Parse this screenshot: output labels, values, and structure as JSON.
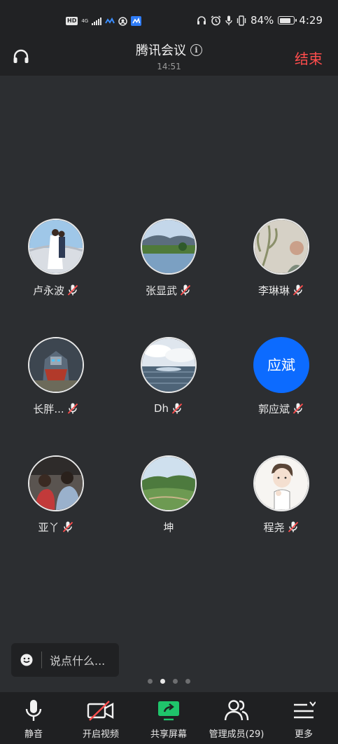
{
  "status_bar": {
    "hd": "HD",
    "network": "4G",
    "battery": "84%",
    "battery_level": 0.84,
    "time": "4:29"
  },
  "header": {
    "title": "腾讯会议",
    "timer": "14:51",
    "end_label": "结束"
  },
  "participants": [
    {
      "name": "卢永波",
      "mic_muted": true,
      "avatar": "photo-couple"
    },
    {
      "name": "张显武",
      "mic_muted": true,
      "avatar": "photo-lake"
    },
    {
      "name": "李琳琳",
      "mic_muted": true,
      "avatar": "photo-plant"
    },
    {
      "name": "长胖...",
      "mic_muted": true,
      "avatar": "photo-robot"
    },
    {
      "name": "Dh",
      "mic_muted": true,
      "avatar": "photo-sea"
    },
    {
      "name": "郭应斌",
      "mic_muted": true,
      "avatar_text": "应斌",
      "avatar_color": "#0c6bff"
    },
    {
      "name": "亚丫",
      "mic_muted": true,
      "avatar": "photo-children"
    },
    {
      "name": "坤",
      "mic_muted": false,
      "avatar": "photo-mountain"
    },
    {
      "name": "程尧",
      "mic_muted": true,
      "avatar": "cartoon-boy"
    }
  ],
  "chat": {
    "placeholder": "说点什么..."
  },
  "pager": {
    "pages": 4,
    "current": 2
  },
  "toolbar": {
    "mute_label": "静音",
    "video_label": "开启视频",
    "share_label": "共享屏幕",
    "members_label": "管理成员(29)",
    "more_label": "更多"
  },
  "colors": {
    "end_red": "#ff4d4d",
    "share_green": "#1fc46b",
    "avatar_blue": "#0c6bff",
    "mute_red": "#ff4d4d"
  }
}
